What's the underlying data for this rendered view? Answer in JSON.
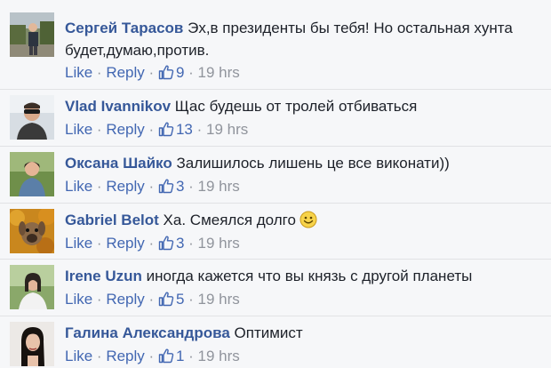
{
  "actions": {
    "like": "Like",
    "reply": "Reply",
    "dot": "·"
  },
  "comments": [
    {
      "author": "Сергей Тарасов",
      "text": "Эх,в президенты бы тебя! Но остальная хунта",
      "text2": "будет,думаю,против.",
      "likes": "9",
      "time": "19 hrs",
      "avatar": "man-outdoors-photo"
    },
    {
      "author": "Vlad Ivannikov",
      "text": "Щас будешь от тролей отбиваться",
      "likes": "13",
      "time": "19 hrs",
      "avatar": "man-sunglasses-photo"
    },
    {
      "author": "Оксана Шайко",
      "text": "Залишилось лишень це все виконати))",
      "likes": "3",
      "time": "19 hrs",
      "avatar": "woman-park-photo"
    },
    {
      "author": "Gabriel Belot",
      "text": "Ха. Смеялся долго",
      "emoji": "smiley-icon",
      "likes": "3",
      "time": "19 hrs",
      "avatar": "dog-autumn-photo"
    },
    {
      "author": "Irene Uzun",
      "text": "иногда кажется что вы князь с другой планеты",
      "likes": "5",
      "time": "19 hrs",
      "avatar": "woman-portrait-photo"
    },
    {
      "author": "Галина Александрова",
      "text": "Оптимист",
      "likes": "1",
      "time": "19 hrs",
      "avatar": "woman-dark-hair-photo"
    }
  ],
  "colors": {
    "author": "#365899",
    "link": "#4267b2",
    "meta": "#90949c",
    "text": "#1d2129",
    "background": "#f6f7f9"
  }
}
